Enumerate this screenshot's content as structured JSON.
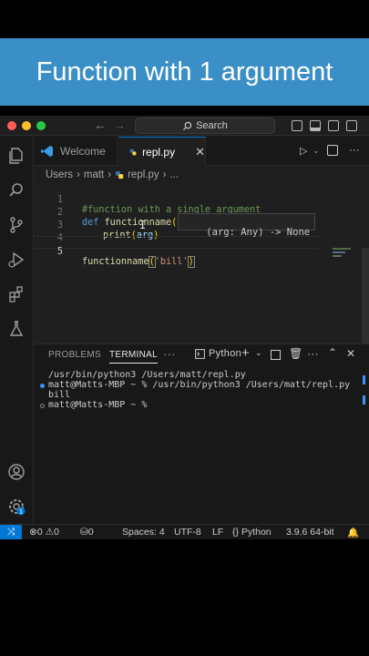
{
  "banner": {
    "title": "Function with 1 argument"
  },
  "titlebar": {
    "search_label": "Search"
  },
  "tabs": [
    {
      "label": "Welcome"
    },
    {
      "label": "repl.py"
    }
  ],
  "breadcrumb": {
    "folder1": "Users",
    "folder2": "matt",
    "file": "repl.py",
    "more": "..."
  },
  "editor": {
    "lines": [
      {
        "num": "1",
        "comment": "#function with a single argument"
      },
      {
        "num": "2",
        "kw": "def",
        "fn": "functionname",
        "open": "(",
        "param": "arg",
        "close": "):"
      },
      {
        "num": "3",
        "fn": "print",
        "open": "(",
        "param": "arg",
        "close": ")"
      },
      {
        "num": "4"
      },
      {
        "num": "5",
        "fn": "functionname",
        "open": "(",
        "str": "'bill'",
        "close": ")"
      }
    ],
    "hint": "(arg: Any) -> None"
  },
  "panel": {
    "tabs": [
      "PROBLEMS",
      "TERMINAL",
      "···"
    ],
    "shell_label": "Python",
    "terminal_lines": [
      "/usr/bin/python3 /Users/matt/repl.py",
      "matt@Matts-MBP ~ % /usr/bin/python3 /Users/matt/repl.py",
      "bill",
      "matt@Matts-MBP ~ %"
    ]
  },
  "statusbar": {
    "errors": "0",
    "warnings": "0",
    "ports": "0",
    "spaces": "Spaces: 4",
    "encoding": "UTF-8",
    "eol": "LF",
    "language": "Python",
    "interpreter": "3.9.6 64-bit"
  },
  "colors": {
    "banner": "#3a8fc6",
    "accent": "#0078d4",
    "editor_bg": "#1f1f1f"
  }
}
